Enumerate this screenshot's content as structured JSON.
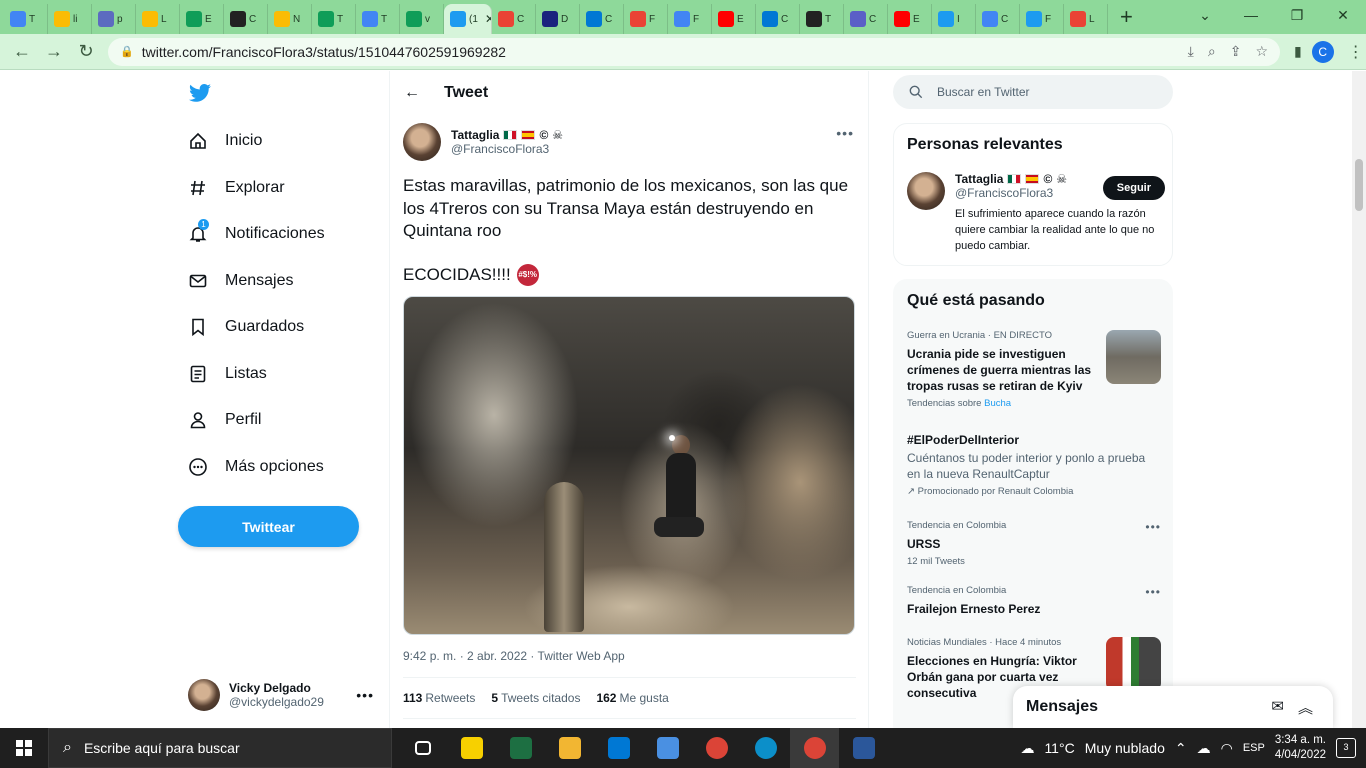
{
  "browser": {
    "tabs": [
      {
        "label": "T",
        "icon": "google-docs-icon",
        "color": "#4285f4"
      },
      {
        "label": "li",
        "icon": "google-drive-icon",
        "color": "#fbbc04"
      },
      {
        "label": "p",
        "icon": "meet-icon",
        "color": "#5c6bc0"
      },
      {
        "label": "L",
        "icon": "google-drive-icon",
        "color": "#fbbc04"
      },
      {
        "label": "E",
        "icon": "google-sheets-icon",
        "color": "#0f9d58"
      },
      {
        "label": "C",
        "icon": "github-icon",
        "color": "#222222"
      },
      {
        "label": "N",
        "icon": "google-drive-icon",
        "color": "#fbbc04"
      },
      {
        "label": "T",
        "icon": "google-sheets-icon",
        "color": "#0f9d58"
      },
      {
        "label": "T",
        "icon": "google-docs-icon",
        "color": "#4285f4"
      },
      {
        "label": "v",
        "icon": "google-sheets-icon",
        "color": "#0f9d58"
      },
      {
        "label": "(1",
        "icon": "twitter-icon",
        "color": "#1d9bf0",
        "active": true
      },
      {
        "label": "C",
        "icon": "google-icon",
        "color": "#ea4335"
      },
      {
        "label": "D",
        "icon": "v-icon",
        "color": "#1a237e"
      },
      {
        "label": "C",
        "icon": "outlook-icon",
        "color": "#0078d4"
      },
      {
        "label": "F",
        "icon": "gmail-icon",
        "color": "#ea4335"
      },
      {
        "label": "F",
        "icon": "google-docs-icon",
        "color": "#4285f4"
      },
      {
        "label": "E",
        "icon": "youtube-icon",
        "color": "#ff0000"
      },
      {
        "label": "C",
        "icon": "outlook-icon",
        "color": "#0078d4"
      },
      {
        "label": "T",
        "icon": "github-icon",
        "color": "#222222"
      },
      {
        "label": "C",
        "icon": "teams-icon",
        "color": "#5b5fc7"
      },
      {
        "label": "E",
        "icon": "youtube-icon",
        "color": "#ff0000"
      },
      {
        "label": "I",
        "icon": "twitter-icon",
        "color": "#1d9bf0"
      },
      {
        "label": "C",
        "icon": "translate-icon",
        "color": "#4285f4"
      },
      {
        "label": "F",
        "icon": "twitter-icon",
        "color": "#1d9bf0"
      },
      {
        "label": "L",
        "icon": "google-icon",
        "color": "#ea4335"
      }
    ],
    "new_tab": "+",
    "url": "twitter.com/FranciscoFlora3/status/1510447602591969282",
    "profile_initial": "C"
  },
  "nav": {
    "items": [
      {
        "label": "Inicio",
        "icon": "home-icon"
      },
      {
        "label": "Explorar",
        "icon": "hashtag-icon"
      },
      {
        "label": "Notificaciones",
        "icon": "bell-icon",
        "badge": "1"
      },
      {
        "label": "Mensajes",
        "icon": "mail-icon"
      },
      {
        "label": "Guardados",
        "icon": "bookmark-icon"
      },
      {
        "label": "Listas",
        "icon": "list-icon"
      },
      {
        "label": "Perfil",
        "icon": "person-icon"
      },
      {
        "label": "Más opciones",
        "icon": "more-circle-icon"
      }
    ],
    "tweet_button": "Twittear",
    "account": {
      "name": "Vicky Delgado",
      "handle": "@vickydelgado29"
    }
  },
  "tweet": {
    "header_title": "Tweet",
    "author_name": "Tattaglia",
    "author_suffix": "©",
    "author_handle": "@FranciscoFlora3",
    "text": "Estas maravillas, patrimonio de los mexicanos, son las que los 4Treros con su Transa Maya están destruyendo en Quintana roo",
    "text2": "ECOCIDAS!!!!",
    "meta": "9:42 p. m. · 2 abr. 2022 · Twitter Web App",
    "stats": [
      {
        "count": "113",
        "label": "Retweets"
      },
      {
        "count": "5",
        "label": "Tweets citados"
      },
      {
        "count": "162",
        "label": "Me gusta"
      }
    ]
  },
  "right": {
    "search_placeholder": "Buscar en Twitter",
    "relevant_title": "Personas relevantes",
    "relevant_user": {
      "name": "Tattaglia",
      "suffix": "©",
      "handle": "@FranciscoFlora3",
      "follow": "Seguir",
      "bio": "El sufrimiento aparece cuando la razón quiere cambiar la realidad ante lo que no puedo cambiar."
    },
    "trends_title": "Qué está pasando",
    "trends": [
      {
        "category": "Guerra en Ucrania · EN DIRECTO",
        "title": "Ucrania pide se investiguen crímenes de guerra mientras las tropas rusas se retiran de Kyiv",
        "sub_prefix": "Tendencias sobre",
        "sub_link": "Bucha"
      },
      {
        "title": "#ElPoderDelInterior",
        "description": "Cuéntanos tu poder interior y ponlo a prueba en la nueva RenaultCaptur",
        "promoted": "Promocionado por Renault Colombia"
      },
      {
        "category": "Tendencia en Colombia",
        "title": "URSS",
        "sub": "12 mil Tweets"
      },
      {
        "category": "Tendencia en Colombia",
        "title": "Frailejon Ernesto Perez"
      },
      {
        "category": "Noticias Mundiales · Hace 4 minutos",
        "title": "Elecciones en Hungría: Viktor Orbán gana por cuarta vez consecutiva"
      }
    ]
  },
  "messages_drawer": {
    "title": "Mensajes"
  },
  "taskbar": {
    "search_placeholder": "Escribe aquí para buscar",
    "apps": [
      {
        "icon": "task-view-icon",
        "color": "#ffffff"
      },
      {
        "icon": "sticky-notes-icon",
        "color": "#f7d000"
      },
      {
        "icon": "excel-icon",
        "color": "#1d6f42"
      },
      {
        "icon": "file-explorer-icon",
        "color": "#f2b632"
      },
      {
        "icon": "mail-app-icon",
        "color": "#0078d4"
      },
      {
        "icon": "store-icon",
        "color": "#4a90e2"
      },
      {
        "icon": "chrome-icon",
        "color": "#db4437"
      },
      {
        "icon": "edge-icon",
        "color": "#0c8fc9"
      },
      {
        "icon": "chrome-profile-icon",
        "color": "#db4437"
      },
      {
        "icon": "word-icon",
        "color": "#2b579a"
      }
    ],
    "weather": "11°C",
    "weather_desc": "Muy nublado",
    "lang": "ESP",
    "time": "3:34 a. m.",
    "date": "4/04/2022",
    "notifications": "3"
  }
}
